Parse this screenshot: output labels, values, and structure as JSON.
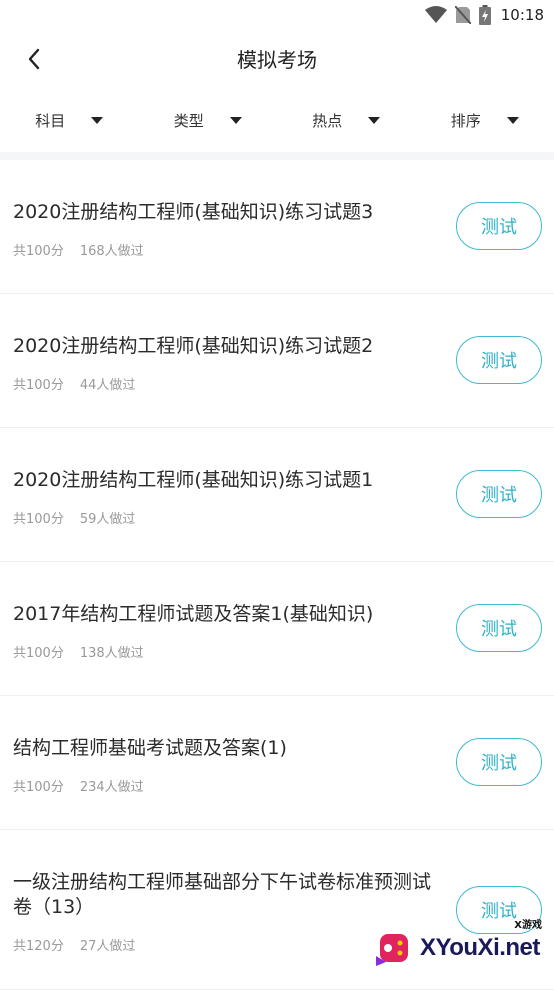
{
  "status_bar": {
    "time": "10:18"
  },
  "header": {
    "title": "模拟考场"
  },
  "filters": [
    {
      "label": "科目"
    },
    {
      "label": "类型"
    },
    {
      "label": "热点"
    },
    {
      "label": "排序"
    }
  ],
  "items": [
    {
      "title": "2020注册结构工程师(基础知识)练习试题3",
      "score": "共100分",
      "count": "168人做过",
      "button": "测试"
    },
    {
      "title": "2020注册结构工程师(基础知识)练习试题2",
      "score": "共100分",
      "count": "44人做过",
      "button": "测试"
    },
    {
      "title": "2020注册结构工程师(基础知识)练习试题1",
      "score": "共100分",
      "count": "59人做过",
      "button": "测试"
    },
    {
      "title": "2017年结构工程师试题及答案1(基础知识)",
      "score": "共100分",
      "count": "138人做过",
      "button": "测试"
    },
    {
      "title": "结构工程师基础考试题及答案(1)",
      "score": "共100分",
      "count": "234人做过",
      "button": "测试"
    },
    {
      "title": "一级注册结构工程师基础部分下午试卷标准预测试卷（13）",
      "score": "共120分",
      "count": "27人做过",
      "button": "测试"
    }
  ],
  "watermark": {
    "text": "XYouXi.net",
    "small": "X游戏"
  }
}
